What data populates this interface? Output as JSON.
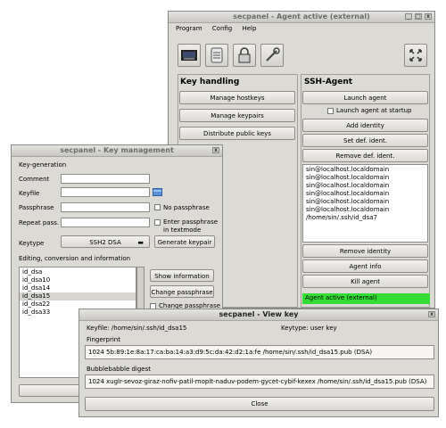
{
  "main_window": {
    "title": "secpanel - Agent active (external)",
    "menu": [
      "Program",
      "Config",
      "Help"
    ],
    "toolbar_icons": [
      "terminal-icon",
      "key-ring-icon",
      "padlock-icon",
      "tools-icon",
      "expand-icon"
    ],
    "key_handling": {
      "heading": "Key handling",
      "buttons": [
        "Manage hostkeys",
        "Manage keypairs",
        "Distribute public keys"
      ]
    },
    "ssh_agent": {
      "heading": "SSH-Agent",
      "launch_label": "Launch agent",
      "launch_startup_label": "Launch agent at startup",
      "add_identity_label": "Add identity",
      "set_default_label": "Set def. ident.",
      "remove_default_label": "Remove def. ident.",
      "identities": [
        "sin@localhost.localdomain",
        "sin@localhost.localdomain",
        "sin@localhost.localdomain",
        "sin@localhost.localdomain",
        "sin@localhost.localdomain",
        "sin@localhost.localdomain",
        "/home/sin/.ssh/id_dsa7"
      ],
      "remove_identity_label": "Remove identity",
      "agent_info_label": "Agent info",
      "kill_agent_label": "Kill agent",
      "status": "Agent active (external)",
      "status_color": "#33dd33"
    }
  },
  "key_window": {
    "title": "secpanel - Key management",
    "keygen_heading": "Key-generation",
    "comment_label": "Comment",
    "keyfile_label": "Keyfile",
    "passphrase_label": "Passphrase",
    "no_passphrase_label": "No passphrase",
    "repeat_label": "Repeat pass.",
    "textmode_label_1": "Enter passphrase",
    "textmode_label_2": "in textmode",
    "keytype_label": "Keytype",
    "keytype_value": "SSH2 DSA",
    "generate_label": "Generate keypair",
    "editing_heading": "Editing, conversion and information",
    "keys": [
      "id_dsa",
      "id_dsa10",
      "id_dsa14",
      "id_dsa15",
      "id_dsa22",
      "id_dsa33"
    ],
    "selected_key": "id_dsa15",
    "show_info_label": "Show information",
    "change_pass_label": "Change passphrase",
    "change_pass_partial_label": "Change passphrase"
  },
  "view_key_window": {
    "title": "secpanel - View key",
    "keyfile_text": "Keyfile: /home/sin/.ssh/id_dsa15",
    "keytype_text": "Keytype: user key",
    "fingerprint_heading": "Fingerprint",
    "fingerprint_value": "1024 5b:89:1e:8a:17:ca:ba:14:a3:d9:5c:da:42:d2:1a:fe /home/sin/.ssh/id_dsa15.pub (DSA)",
    "bubble_heading": "Bubblebabble digest",
    "bubble_value": "1024 xuglr-sevoz-giraz-nofiv-patil-mopit-naduv-podem-gycet-cybif-kexex /home/sin/.ssh/id_dsa15.pub (DSA)",
    "close_label": "Close"
  }
}
